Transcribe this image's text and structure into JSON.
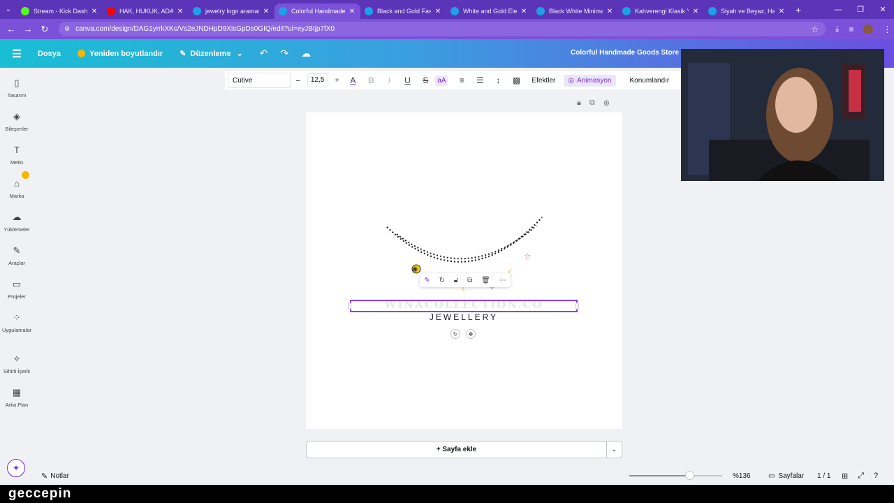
{
  "browser": {
    "tabs": [
      {
        "title": "Stream - Kick Dashbo",
        "icon": "kick-icon",
        "color": "#53fc18",
        "active": false
      },
      {
        "title": "HAK, HUKUK, ADALET",
        "icon": "youtube-icon",
        "color": "#ff0000",
        "active": false
      },
      {
        "title": "jewelry logo araması",
        "icon": "canva-icon",
        "color": "#1da1e6",
        "active": false
      },
      {
        "title": "Colorful Handmade G",
        "icon": "canva-icon",
        "color": "#1da1e6",
        "active": true
      },
      {
        "title": "Black and Gold Fashi",
        "icon": "canva-icon",
        "color": "#1da1e6",
        "active": false
      },
      {
        "title": "White and Gold Eleg",
        "icon": "canva-icon",
        "color": "#1da1e6",
        "active": false
      },
      {
        "title": "Black White Minimali",
        "icon": "canva-icon",
        "color": "#1da1e6",
        "active": false
      },
      {
        "title": "Kahverengi Klasik Yu",
        "icon": "canva-icon",
        "color": "#1da1e6",
        "active": false
      },
      {
        "title": "Siyah ve Beyaz, Hare",
        "icon": "canva-icon",
        "color": "#1da1e6",
        "active": false
      }
    ],
    "url": "canva.com/design/DAG1yrrkXKc/Vs2eJNDHpD9XisGpDs0GIQ/edit?ui=eyJBIjp7fX0"
  },
  "header": {
    "file_label": "Dosya",
    "resize_label": "Yeniden boyutlandır",
    "edit_label": "Düzenleme",
    "doc_title": "Colorful Handmade Goods Store Lo"
  },
  "sidebar": {
    "items": [
      {
        "label": "Tasarım",
        "icon": "design-icon",
        "glyph": "▯"
      },
      {
        "label": "Bileşenler",
        "icon": "elements-icon",
        "glyph": "◈"
      },
      {
        "label": "Metin",
        "icon": "text-icon",
        "glyph": "T"
      },
      {
        "label": "Marka",
        "icon": "brand-icon",
        "glyph": "⌂"
      },
      {
        "label": "Yüklemeler",
        "icon": "upload-icon",
        "glyph": "☁"
      },
      {
        "label": "Araçlar",
        "icon": "tools-icon",
        "glyph": "✎"
      },
      {
        "label": "Projeler",
        "icon": "folder-icon",
        "glyph": "▭"
      },
      {
        "label": "Uygulamalar",
        "icon": "apps-icon",
        "glyph": "⁘"
      },
      {
        "label": "Sihirli İçerik",
        "icon": "magic-media-icon",
        "glyph": "✧"
      },
      {
        "label": "Arka Plan",
        "icon": "background-icon",
        "glyph": "▦"
      }
    ]
  },
  "text_toolbar": {
    "font": "Cutive",
    "size": "12,5",
    "effects_label": "Efektler",
    "animation_label": "Animasyon",
    "position_label": "Konumlandır"
  },
  "canvas": {
    "brand_text": "WINACOLLECTION.CO",
    "sub_text": "JEWELLERY",
    "add_page_label": "+ Sayfa ekle"
  },
  "bottom_bar": {
    "notes_label": "Notlar",
    "zoom_percent": 65,
    "zoom_label": "%136",
    "pages_label": "Sayfalar",
    "page_count": "1 / 1"
  },
  "watermark": {
    "text": "geccepin"
  },
  "colors": {
    "accent": "#8b3dff",
    "tabbar": "#5b34b8",
    "addressbar": "#7b51d9"
  }
}
